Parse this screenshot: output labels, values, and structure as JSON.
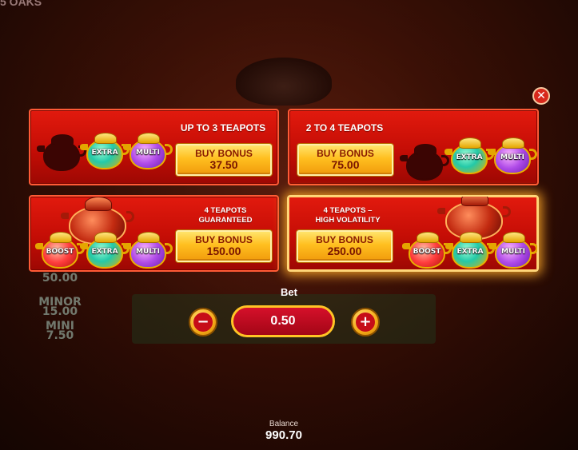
{
  "background": {
    "game_title_fragment": "5 OAKS",
    "jackpots": [
      {
        "label": "",
        "value": "50.00"
      },
      {
        "label": "MINOR",
        "value": "15.00"
      },
      {
        "label": "MINI",
        "value": "7.50"
      }
    ]
  },
  "close_label": "✕",
  "cards": [
    {
      "title": "UP TO 3 TEAPOTS",
      "button_label": "BUY BONUS",
      "price": "37.50",
      "pots": [
        {
          "kind": "silhouette",
          "label": ""
        },
        {
          "kind": "extra",
          "label": "EXTRA"
        },
        {
          "kind": "multi",
          "label": "MULTI"
        }
      ]
    },
    {
      "title": "2 TO 4 TEAPOTS",
      "button_label": "BUY BONUS",
      "price": "75.00",
      "pots": [
        {
          "kind": "silhouette",
          "label": ""
        },
        {
          "kind": "extra",
          "label": "EXTRA"
        },
        {
          "kind": "multi",
          "label": "MULTI"
        }
      ]
    },
    {
      "title": "4 TEAPOTS\nGUARANTEED",
      "button_label": "BUY BONUS",
      "price": "150.00",
      "pots": [
        {
          "kind": "boost",
          "label": "BOOST"
        },
        {
          "kind": "extra",
          "label": "EXTRA"
        },
        {
          "kind": "multi",
          "label": "MULTI"
        }
      ]
    },
    {
      "title": "4 TEAPOTS –\nHIGH VOLATILITY",
      "button_label": "BUY BONUS",
      "price": "250.00",
      "highlighted": true,
      "pots": [
        {
          "kind": "boost",
          "label": "BOOST"
        },
        {
          "kind": "extra",
          "label": "EXTRA"
        },
        {
          "kind": "multi",
          "label": "MULTI"
        }
      ]
    }
  ],
  "bet": {
    "label": "Bet",
    "value": "0.50",
    "minus": "−",
    "plus": "+"
  },
  "balance": {
    "label": "Balance",
    "value": "990.70"
  },
  "colors": {
    "card_red": "#d01508",
    "button_gold": "#ffbf1f",
    "bet_red": "#c00a20",
    "highlight_glow": "#ffaa28"
  }
}
